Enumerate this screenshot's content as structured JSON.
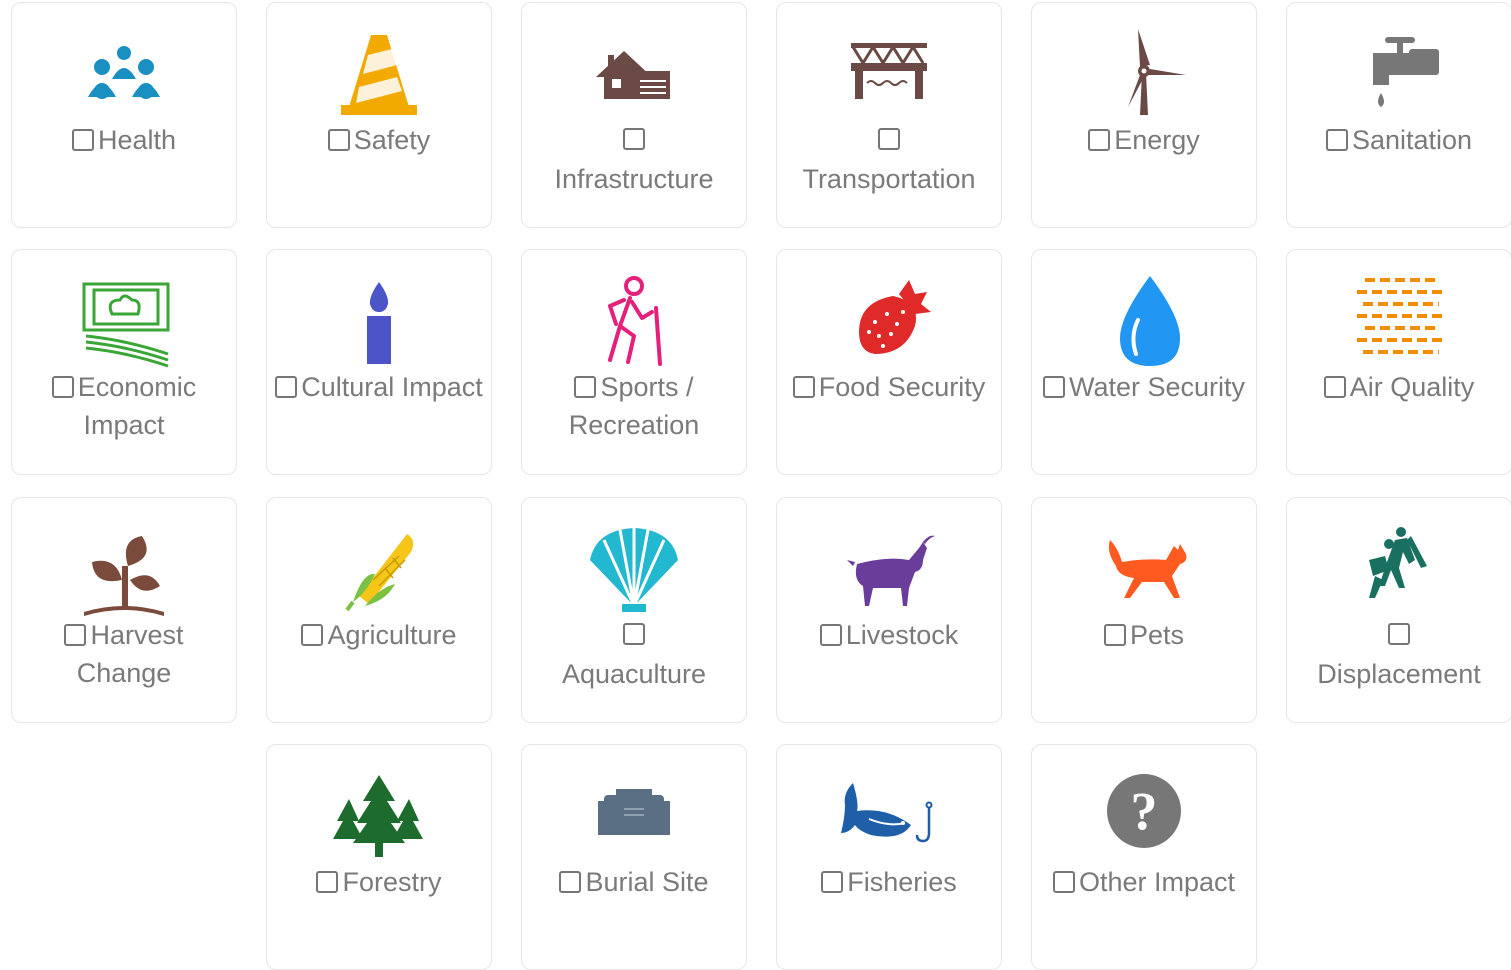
{
  "categories": [
    {
      "label": "Health",
      "icon": "health-people-icon",
      "color": "#1a8fc1"
    },
    {
      "label": "Safety",
      "icon": "traffic-cone-icon",
      "color": "#f2a900"
    },
    {
      "label": "Infrastructure",
      "icon": "house-icon",
      "color": "#6b4a46"
    },
    {
      "label": "Transportation",
      "icon": "bridge-icon",
      "color": "#6b4a46"
    },
    {
      "label": "Energy",
      "icon": "wind-turbine-icon",
      "color": "#6b4a46"
    },
    {
      "label": "Sanitation",
      "icon": "faucet-icon",
      "color": "#777777"
    },
    {
      "label": "Economic Impact",
      "icon": "money-icon",
      "color": "#3aa635"
    },
    {
      "label": "Cultural Impact",
      "icon": "candle-icon",
      "color": "#4c55c8"
    },
    {
      "label": "Sports / Recreation",
      "icon": "hiker-icon",
      "color": "#e4207a"
    },
    {
      "label": "Food Security",
      "icon": "strawberry-icon",
      "color": "#e02a2a"
    },
    {
      "label": "Water Security",
      "icon": "water-drop-icon",
      "color": "#2196f3"
    },
    {
      "label": "Air Quality",
      "icon": "air-lines-icon",
      "color": "#f28c00"
    },
    {
      "label": "Harvest Change",
      "icon": "plant-icon",
      "color": "#7a4a3a"
    },
    {
      "label": "Agriculture",
      "icon": "corn-icon",
      "color": "#7cc242"
    },
    {
      "label": "Aquaculture",
      "icon": "shell-icon",
      "color": "#22b8cf"
    },
    {
      "label": "Livestock",
      "icon": "goat-icon",
      "color": "#6a3d9a"
    },
    {
      "label": "Pets",
      "icon": "dog-icon",
      "color": "#ff5a1f"
    },
    {
      "label": "Displacement",
      "icon": "refugees-icon",
      "color": "#1a7060"
    },
    {
      "label": "Forestry",
      "icon": "trees-icon",
      "color": "#1e6b2e"
    },
    {
      "label": "Burial Site",
      "icon": "tomb-icon",
      "color": "#5a6f84"
    },
    {
      "label": "Fisheries",
      "icon": "fish-icon",
      "color": "#1f5fa8"
    },
    {
      "label": "Other Impact",
      "icon": "question-icon",
      "color": "#777777"
    }
  ]
}
